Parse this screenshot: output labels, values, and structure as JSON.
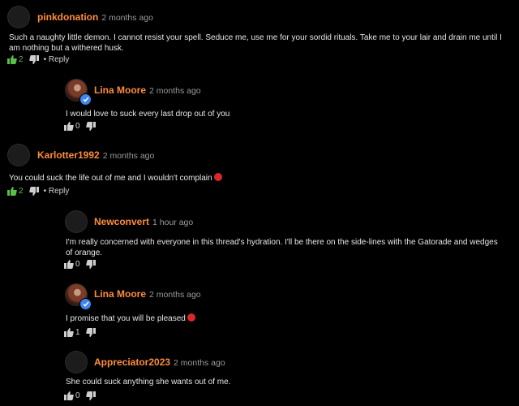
{
  "comments": [
    {
      "username": "pinkdonation",
      "time": "2 months ago",
      "text": "Such a naughty little demon. I cannot resist your spell. Seduce me, use me for your sordid rituals. Take me to your lair and drain me until I am nothing but a withered husk.",
      "likes": "2",
      "reply": "• Reply"
    },
    {
      "username": "Lina Moore",
      "time": "2 months ago",
      "text": "I would love to suck every last drop out of you",
      "likes": "0"
    },
    {
      "username": "Karlotter1992",
      "time": "2 months ago",
      "text": "You could suck the life out of me and I wouldn't complain",
      "likes": "2",
      "reply": "• Reply"
    },
    {
      "username": "Newconvert",
      "time": "1 hour ago",
      "text": "I'm really concerned with everyone in this thread's hydration. I'll be there on the side-lines with the Gatorade and wedges of orange.",
      "likes": "0"
    },
    {
      "username": "Lina Moore",
      "time": "2 months ago",
      "text": "I promise that you will be pleased",
      "likes": "1"
    },
    {
      "username": "Appreciator2023",
      "time": "2 months ago",
      "text": "She could suck anything she wants out of me.",
      "likes": "0"
    }
  ],
  "colors": {
    "background": "#000000",
    "username": "#ff8c3a",
    "liked": "#5bbd4a",
    "verified": "#3d86f2",
    "emoji": "#d8282c"
  }
}
